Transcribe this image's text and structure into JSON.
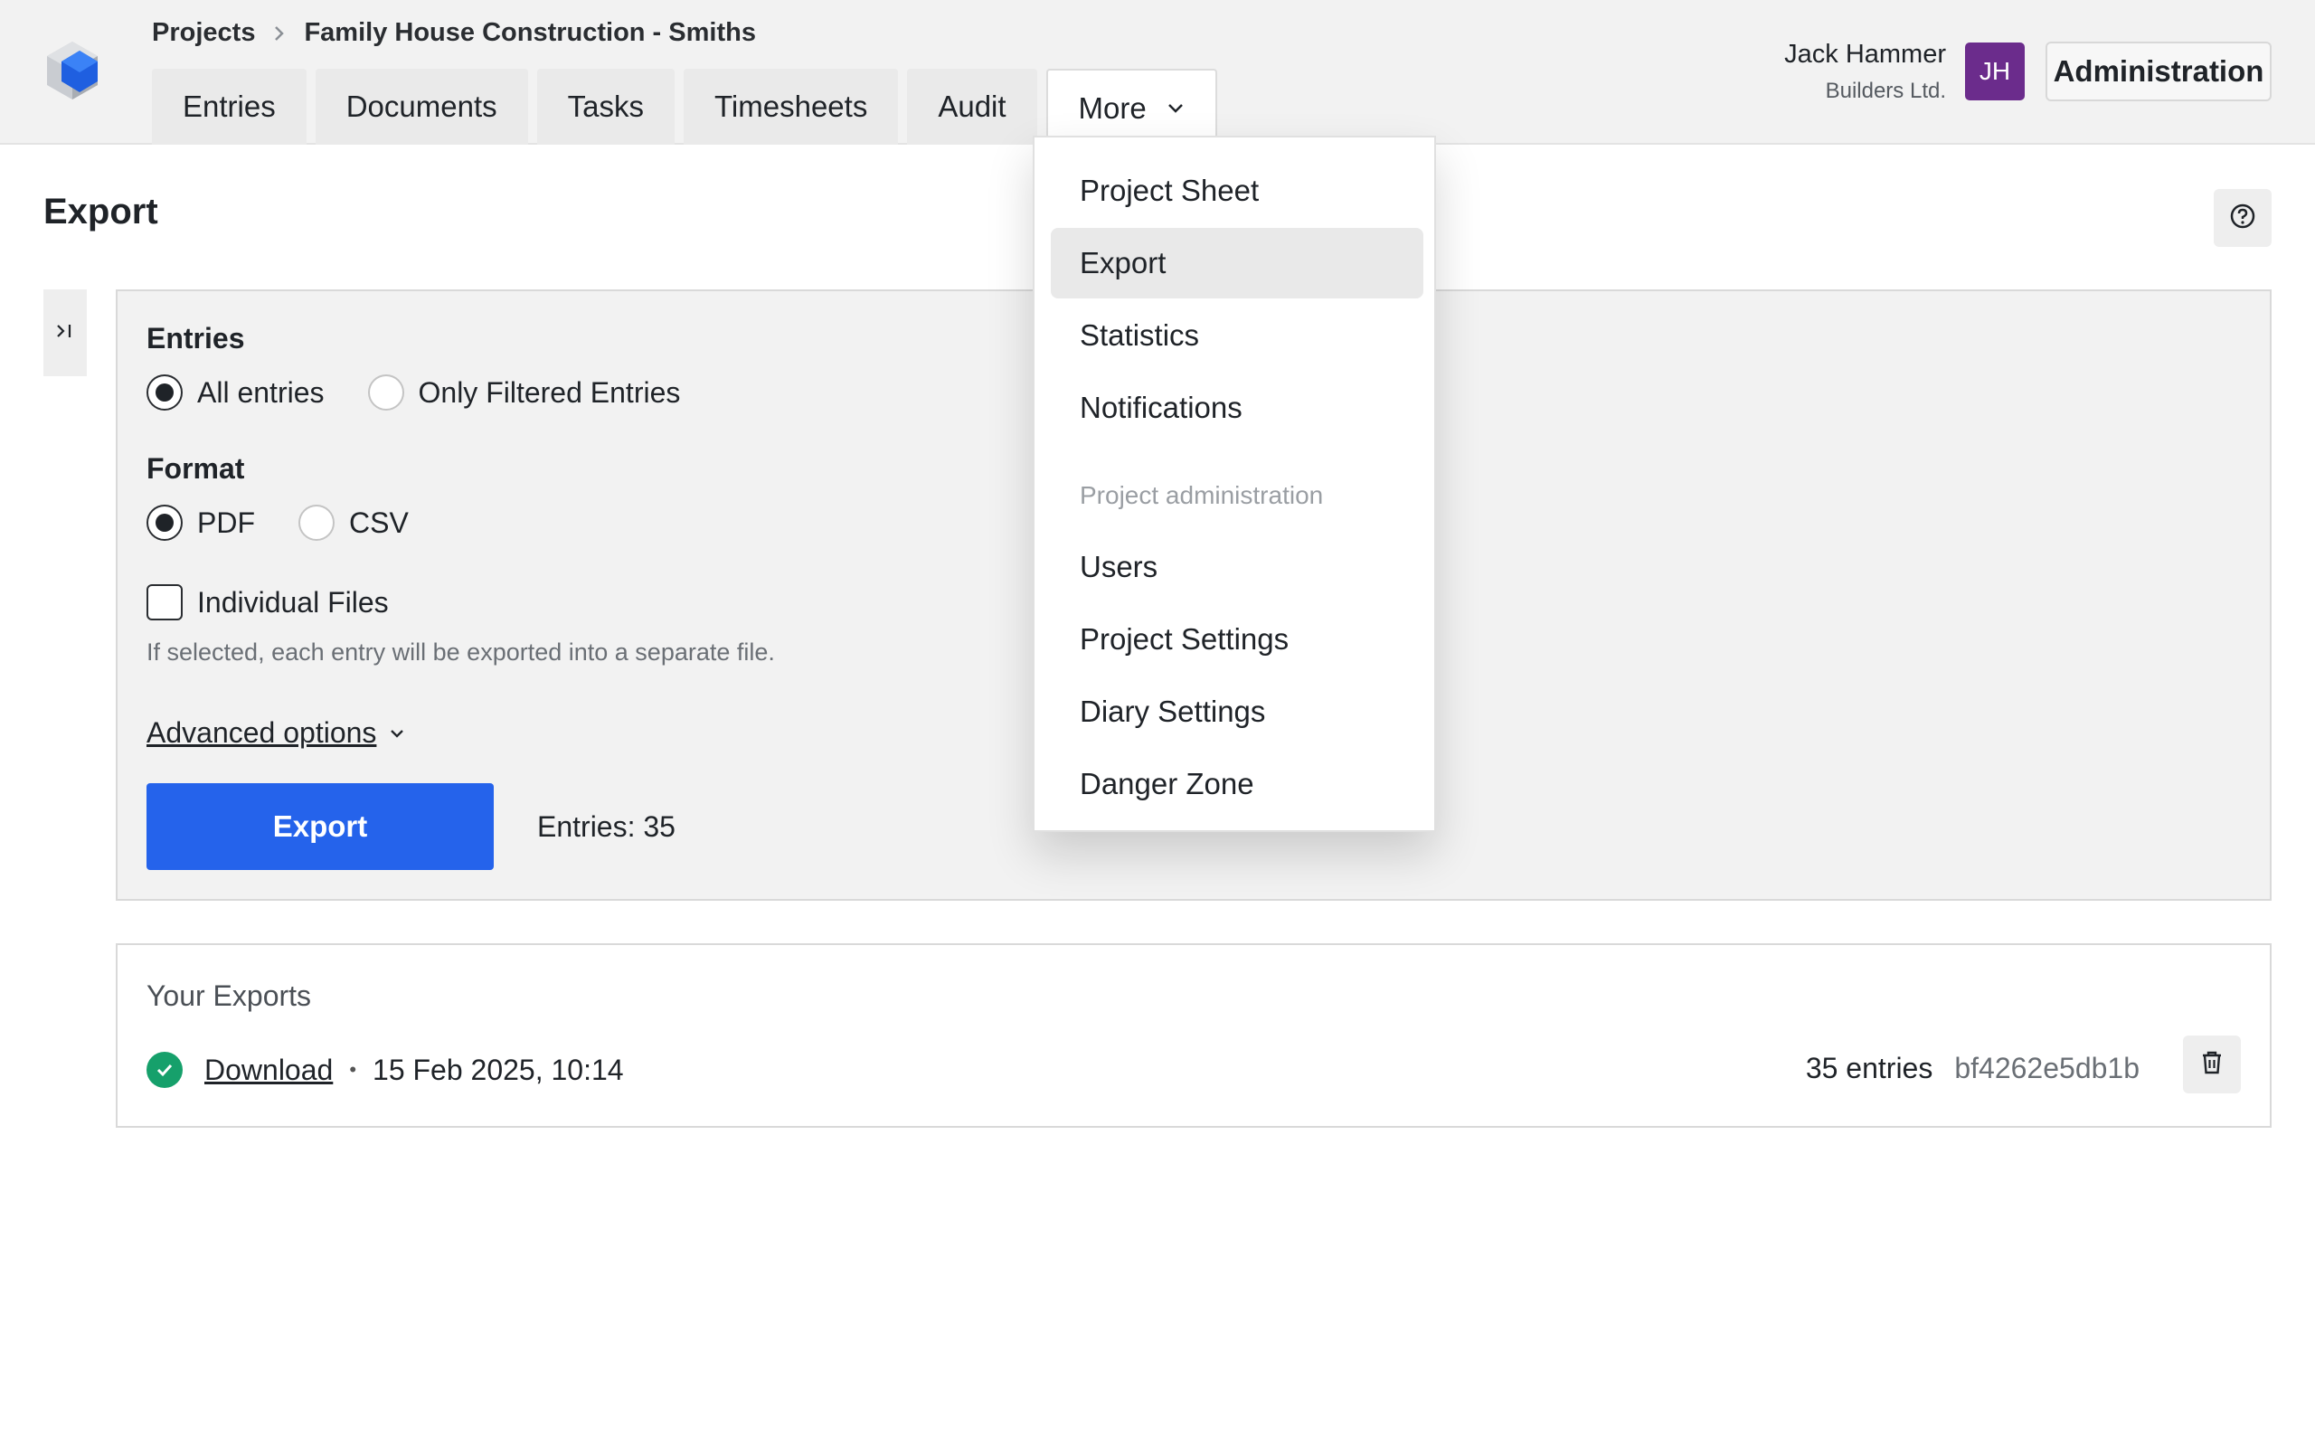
{
  "breadcrumb": {
    "root": "Projects",
    "current": "Family House Construction - Smiths"
  },
  "tabs": [
    "Entries",
    "Documents",
    "Tasks",
    "Timesheets",
    "Audit",
    "More"
  ],
  "user": {
    "name": "Jack Hammer",
    "company": "Builders Ltd.",
    "initials": "JH",
    "avatar_color": "#6b2c8c"
  },
  "admin_button": "Administration",
  "page_title": "Export",
  "form": {
    "entries_label": "Entries",
    "entries_options": [
      "All entries",
      "Only Filtered Entries"
    ],
    "entries_selected": "All entries",
    "format_label": "Format",
    "format_options": [
      "PDF",
      "CSV"
    ],
    "format_selected": "PDF",
    "individual_files_label": "Individual Files",
    "individual_files_checked": false,
    "individual_files_hint": "If selected, each entry will be exported into a separate file.",
    "advanced_options": "Advanced options",
    "export_button": "Export",
    "entries_count": "Entries: 35"
  },
  "your_exports": {
    "title": "Your Exports",
    "items": [
      {
        "status": "success",
        "link": "Download",
        "bullet": "•",
        "date": "15 Feb 2025, 10:14",
        "count": "35 entries",
        "hash": "bf4262e5db1b"
      }
    ]
  },
  "dropdown": {
    "items": [
      "Project Sheet",
      "Export",
      "Statistics",
      "Notifications"
    ],
    "active": "Export",
    "section_heading": "Project administration",
    "admin_items": [
      "Users",
      "Project Settings",
      "Diary Settings",
      "Danger Zone"
    ]
  },
  "colors": {
    "accent": "#2563eb",
    "success": "#16a06b",
    "logo_blue": "#1f5fe0"
  },
  "icons": {
    "logo": "cube-logo-icon",
    "breadcrumb_separator": "chevron-right-icon",
    "more_chevron": "chevron-down-icon",
    "help": "question-circle-icon",
    "sidebar_toggle": "panel-expand-icon",
    "advanced_chevron": "chevron-down-icon",
    "status": "check-circle-icon",
    "delete": "trash-icon"
  }
}
